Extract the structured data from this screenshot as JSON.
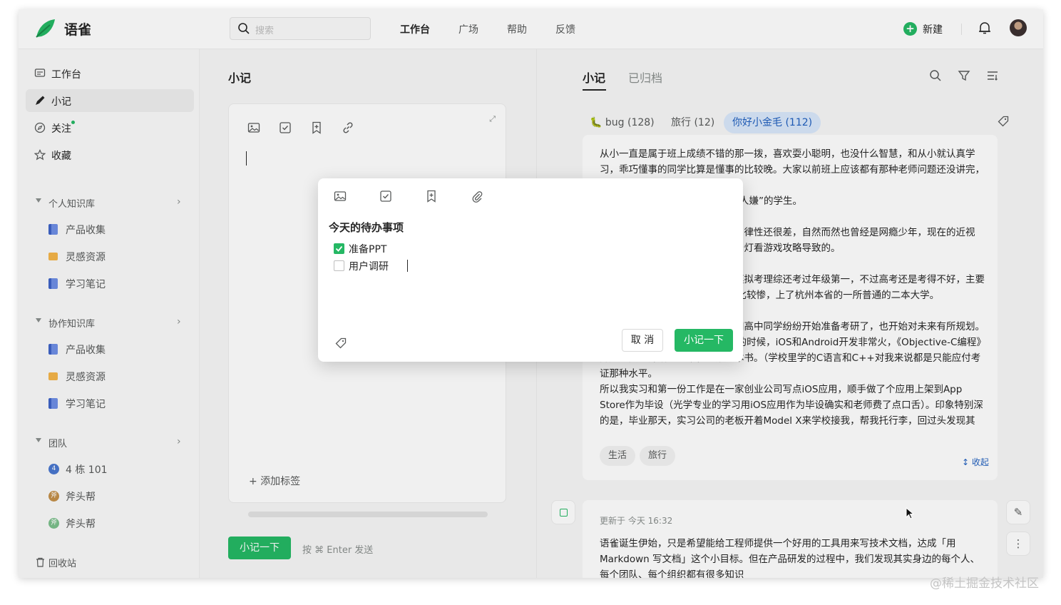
{
  "app": {
    "name": "语雀"
  },
  "header": {
    "search_placeholder": "搜索",
    "nav": [
      "工作台",
      "广场",
      "帮助",
      "反馈"
    ],
    "new_label": "新建"
  },
  "sidebar": {
    "items": [
      {
        "label": "工作台",
        "icon": "workbench-icon"
      },
      {
        "label": "小记",
        "icon": "pen-icon"
      },
      {
        "label": "关注",
        "icon": "compass-icon"
      },
      {
        "label": "收藏",
        "icon": "star-icon"
      }
    ],
    "groups": [
      {
        "label": "个人知识库",
        "items": [
          "产品收集",
          "灵感资源",
          "学习笔记"
        ]
      },
      {
        "label": "协作知识库",
        "items": [
          "产品收集",
          "灵感资源",
          "学习笔记"
        ]
      },
      {
        "label": "团队",
        "items": [
          "4 栋 101",
          "斧头帮",
          "斧头帮"
        ],
        "avatars": [
          "4",
          "斧",
          "斧"
        ]
      }
    ],
    "trash": "回收站"
  },
  "middle": {
    "title": "小记",
    "add_tag": "添加标签",
    "submit": "小记一下",
    "hint": "按 ⌘ Enter 发送"
  },
  "right": {
    "tabs": [
      "小记",
      "已归档"
    ],
    "filters": [
      {
        "label": "bug (128)",
        "emoji": "🐛"
      },
      {
        "label": "旅行 (12)"
      },
      {
        "label": "你好小金毛 (112)"
      }
    ],
    "card": {
      "paragraphs": [
        "从小一直是属于班上成绩不错的那一拨，喜欢耍小聪明，也没什么智慧，和从小就认真学习，乖巧懂事的同学比算是懂事的比较晚。大家以前班上应该都有那种老师问题还没讲完，就",
        "举手抢答的学生，我就是那种“讨人嫌”的学生。",
        "因为家里比较早接触电脑的时候自律性还很差，自然而然也曾经是网瘾少年，现在的近视眼，高就是因为以前经常半夜开台灯看游戏攻略导致的。",
        "高中的学习算比较认真，高三的模拟考理综还考过年级第一，不过高考还是考得不好，主要是因为语文只考了80分，英语也比较惨，上了杭州本省的一所普通的二本大学。",
        "大学临近毕业，身边班里的学霸和高中同学纷纷开始准备考研了，也开始对未来有所规划。大概是14年，杭州正值全民创业的时候，iOS和Android开发非常火，《Objective-C编程》算是我真正开始学习编程的第一本书。（学校里学的C语言和C++对我来说都是只能应付考证那种水平。",
        "所以我实习和第一份工作是在一家创业公司写点iOS应用，顺手做了个应用上架到App Store作为毕设（光学专业的学习用iOS应用作为毕设确实和老师费了点口舌）。印象特别深的是，毕业那天，实习公司的老板开着Model X来学校接我，帮我托行李，回过头发现其实特别幸运，工作到目前为止遇到的老板都非常赞"
      ],
      "tags": [
        "生活",
        "旅行"
      ],
      "collapse": "收起"
    },
    "card2": {
      "meta": "更新于 今天 16:32",
      "body": "语雀诞生伊始，只是希望能给工程师提供一个好用的工具用来写技术文档，达成「用 Markdown 写文档」这个小目标。但在产品研发的过程中，我们发现其实身边的每个人、每个团队、每个组织都有很多知识"
    }
  },
  "modal": {
    "title": "今天的待办事项",
    "todos": [
      {
        "label": "准备PPT",
        "checked": true
      },
      {
        "label": "用户调研",
        "checked": false
      }
    ],
    "cancel": "取 消",
    "ok": "小记一下"
  },
  "watermark": "@稀土掘金技术社区",
  "colors": {
    "accent": "#25b864",
    "selected_chip": "#d9e8fb",
    "link": "#1f5fbf"
  }
}
